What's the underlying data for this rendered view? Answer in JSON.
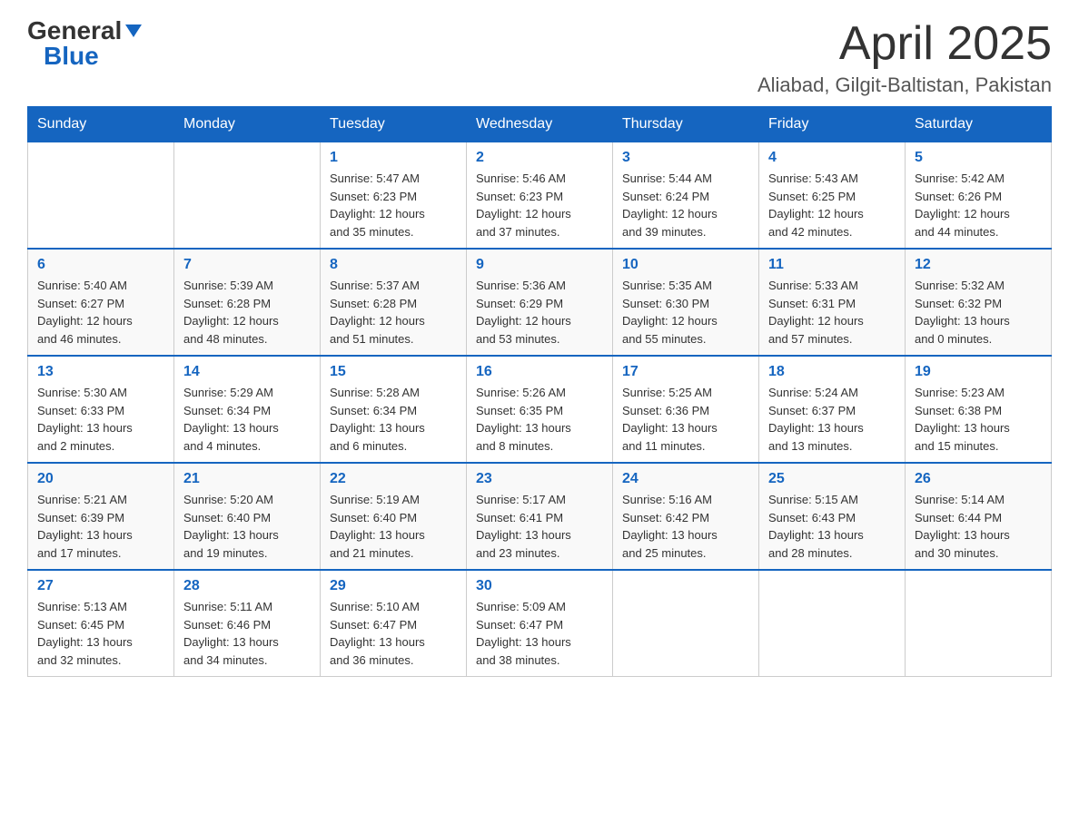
{
  "header": {
    "logo_general": "General",
    "logo_blue": "Blue",
    "month_title": "April 2025",
    "location": "Aliabad, Gilgit-Baltistan, Pakistan"
  },
  "days_of_week": [
    "Sunday",
    "Monday",
    "Tuesday",
    "Wednesday",
    "Thursday",
    "Friday",
    "Saturday"
  ],
  "weeks": [
    [
      {
        "day": "",
        "info": ""
      },
      {
        "day": "",
        "info": ""
      },
      {
        "day": "1",
        "info": "Sunrise: 5:47 AM\nSunset: 6:23 PM\nDaylight: 12 hours\nand 35 minutes."
      },
      {
        "day": "2",
        "info": "Sunrise: 5:46 AM\nSunset: 6:23 PM\nDaylight: 12 hours\nand 37 minutes."
      },
      {
        "day": "3",
        "info": "Sunrise: 5:44 AM\nSunset: 6:24 PM\nDaylight: 12 hours\nand 39 minutes."
      },
      {
        "day": "4",
        "info": "Sunrise: 5:43 AM\nSunset: 6:25 PM\nDaylight: 12 hours\nand 42 minutes."
      },
      {
        "day": "5",
        "info": "Sunrise: 5:42 AM\nSunset: 6:26 PM\nDaylight: 12 hours\nand 44 minutes."
      }
    ],
    [
      {
        "day": "6",
        "info": "Sunrise: 5:40 AM\nSunset: 6:27 PM\nDaylight: 12 hours\nand 46 minutes."
      },
      {
        "day": "7",
        "info": "Sunrise: 5:39 AM\nSunset: 6:28 PM\nDaylight: 12 hours\nand 48 minutes."
      },
      {
        "day": "8",
        "info": "Sunrise: 5:37 AM\nSunset: 6:28 PM\nDaylight: 12 hours\nand 51 minutes."
      },
      {
        "day": "9",
        "info": "Sunrise: 5:36 AM\nSunset: 6:29 PM\nDaylight: 12 hours\nand 53 minutes."
      },
      {
        "day": "10",
        "info": "Sunrise: 5:35 AM\nSunset: 6:30 PM\nDaylight: 12 hours\nand 55 minutes."
      },
      {
        "day": "11",
        "info": "Sunrise: 5:33 AM\nSunset: 6:31 PM\nDaylight: 12 hours\nand 57 minutes."
      },
      {
        "day": "12",
        "info": "Sunrise: 5:32 AM\nSunset: 6:32 PM\nDaylight: 13 hours\nand 0 minutes."
      }
    ],
    [
      {
        "day": "13",
        "info": "Sunrise: 5:30 AM\nSunset: 6:33 PM\nDaylight: 13 hours\nand 2 minutes."
      },
      {
        "day": "14",
        "info": "Sunrise: 5:29 AM\nSunset: 6:34 PM\nDaylight: 13 hours\nand 4 minutes."
      },
      {
        "day": "15",
        "info": "Sunrise: 5:28 AM\nSunset: 6:34 PM\nDaylight: 13 hours\nand 6 minutes."
      },
      {
        "day": "16",
        "info": "Sunrise: 5:26 AM\nSunset: 6:35 PM\nDaylight: 13 hours\nand 8 minutes."
      },
      {
        "day": "17",
        "info": "Sunrise: 5:25 AM\nSunset: 6:36 PM\nDaylight: 13 hours\nand 11 minutes."
      },
      {
        "day": "18",
        "info": "Sunrise: 5:24 AM\nSunset: 6:37 PM\nDaylight: 13 hours\nand 13 minutes."
      },
      {
        "day": "19",
        "info": "Sunrise: 5:23 AM\nSunset: 6:38 PM\nDaylight: 13 hours\nand 15 minutes."
      }
    ],
    [
      {
        "day": "20",
        "info": "Sunrise: 5:21 AM\nSunset: 6:39 PM\nDaylight: 13 hours\nand 17 minutes."
      },
      {
        "day": "21",
        "info": "Sunrise: 5:20 AM\nSunset: 6:40 PM\nDaylight: 13 hours\nand 19 minutes."
      },
      {
        "day": "22",
        "info": "Sunrise: 5:19 AM\nSunset: 6:40 PM\nDaylight: 13 hours\nand 21 minutes."
      },
      {
        "day": "23",
        "info": "Sunrise: 5:17 AM\nSunset: 6:41 PM\nDaylight: 13 hours\nand 23 minutes."
      },
      {
        "day": "24",
        "info": "Sunrise: 5:16 AM\nSunset: 6:42 PM\nDaylight: 13 hours\nand 25 minutes."
      },
      {
        "day": "25",
        "info": "Sunrise: 5:15 AM\nSunset: 6:43 PM\nDaylight: 13 hours\nand 28 minutes."
      },
      {
        "day": "26",
        "info": "Sunrise: 5:14 AM\nSunset: 6:44 PM\nDaylight: 13 hours\nand 30 minutes."
      }
    ],
    [
      {
        "day": "27",
        "info": "Sunrise: 5:13 AM\nSunset: 6:45 PM\nDaylight: 13 hours\nand 32 minutes."
      },
      {
        "day": "28",
        "info": "Sunrise: 5:11 AM\nSunset: 6:46 PM\nDaylight: 13 hours\nand 34 minutes."
      },
      {
        "day": "29",
        "info": "Sunrise: 5:10 AM\nSunset: 6:47 PM\nDaylight: 13 hours\nand 36 minutes."
      },
      {
        "day": "30",
        "info": "Sunrise: 5:09 AM\nSunset: 6:47 PM\nDaylight: 13 hours\nand 38 minutes."
      },
      {
        "day": "",
        "info": ""
      },
      {
        "day": "",
        "info": ""
      },
      {
        "day": "",
        "info": ""
      }
    ]
  ]
}
